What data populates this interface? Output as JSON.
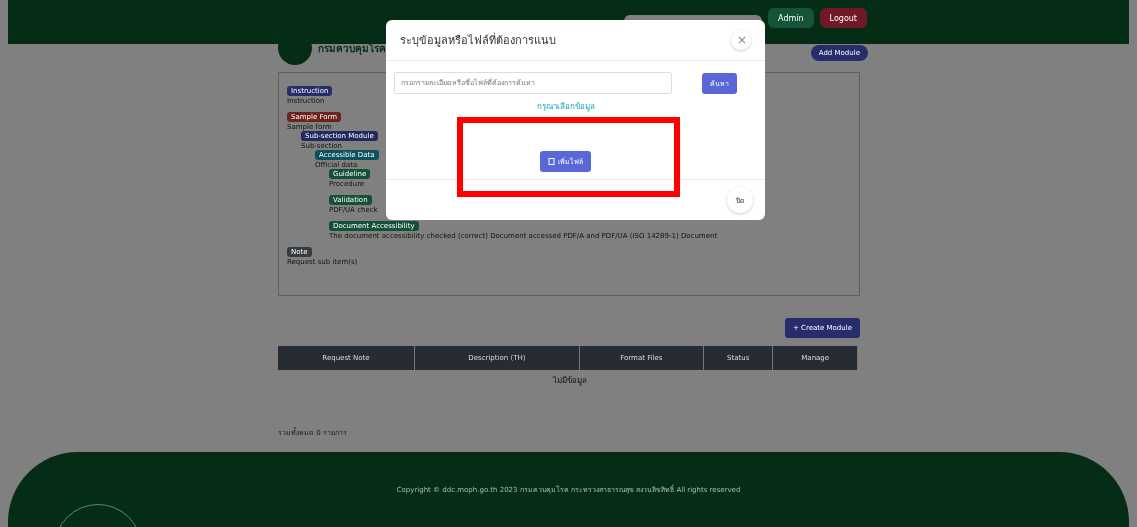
{
  "header": {
    "buttons": [
      {
        "kind": "light"
      },
      {
        "label": "Admin",
        "kind": "success"
      },
      {
        "label": "Logout",
        "kind": "danger"
      }
    ]
  },
  "brand": {
    "name": "กรมควบคุมโรค"
  },
  "add_button": "Add Module",
  "tree": [
    {
      "label": "Instruction",
      "color": "#272d6b",
      "text": "Instruction"
    },
    {
      "label": "Sample Form",
      "color": "#6d241e",
      "text": "Sample form",
      "children": [
        {
          "label": "Sub-section Module",
          "color": "#23295c",
          "text": "Sub-section",
          "children": [
            {
              "label": "Accessible Data",
              "color": "#0c515c",
              "text": "Official data",
              "children": [
                {
                  "label": "Guideline",
                  "color": "#145035",
                  "text": "Procedure"
                },
                {
                  "label": "Validation",
                  "color": "#145035",
                  "text": "PDF/UA check"
                },
                {
                  "label": "Document Accessibility",
                  "color": "#145035",
                  "text": "The document accessibility checked (correct) Document accessed PDF/A and PDF/UA (ISO 14289-1) Document"
                }
              ]
            }
          ]
        }
      ]
    },
    {
      "label": "Note",
      "color": "#363b3f",
      "text": "Request sub item(s)"
    }
  ],
  "create_button": "+ Create Module",
  "table": {
    "columns": [
      "Request Note",
      "Description (TH)",
      "Format Files",
      "Status",
      "Manage"
    ],
    "empty": "ไม่มีข้อมูล"
  },
  "summary": "รวมทั้งหมด 0 รายการ",
  "footer": {
    "copyright": "Copyright © ddc.moph.go.th 2023 กรมควบคุมโรค กระทรวงสาธารณสุข สงวนลิขสิทธิ์ All rights reserved"
  },
  "modal": {
    "title": "ระบุข้อมูลหรือไฟล์ที่ต้องการแนบ",
    "close": "×",
    "search": {
      "placeholder": "กรอกรายละเอียดหรือชื่อไฟล์ที่ต้องการค้นหา"
    },
    "search_button": "ค้นหา",
    "link": "กรุณาเลือกข้อมูล",
    "add_button": "เพิ่มไฟล์",
    "footer_button": "ปิด"
  }
}
